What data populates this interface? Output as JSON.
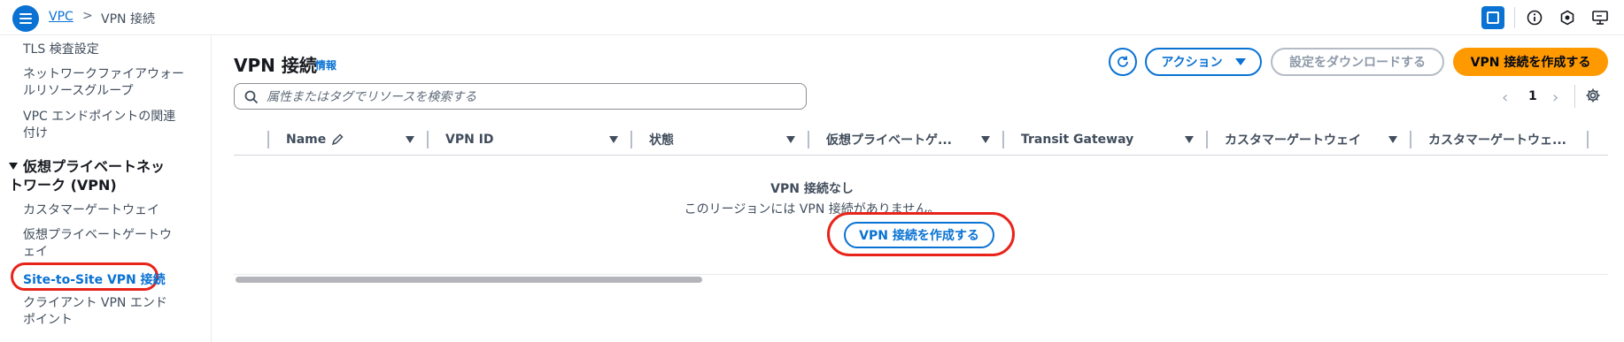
{
  "breadcrumb": {
    "service": "VPC",
    "separator": ">",
    "current": "VPN 接続"
  },
  "topbar_icons": [
    "split-panel-icon",
    "info-icon",
    "notifications-icon",
    "feedback-icon"
  ],
  "sidebar": {
    "items": [
      {
        "label": "TLS 検査設定"
      },
      {
        "label": "ネットワークファイアウォールリソースグループ"
      },
      {
        "label": "VPC エンドポイントの関連付け"
      }
    ],
    "section": "仮想プライベートネットワーク (VPN)",
    "section_items": [
      {
        "label": "カスタマーゲートウェイ"
      },
      {
        "label": "仮想プライベートゲートウェイ"
      },
      {
        "label": "Site-to-Site VPN 接続",
        "active": true
      },
      {
        "label": "クライアント VPN エンドポイント"
      }
    ]
  },
  "main": {
    "title": "VPN 接続",
    "info": "情報",
    "actions_label": "アクション",
    "download_label": "設定をダウンロードする",
    "create_label": "VPN 接続を作成する",
    "search_placeholder": "属性またはタグでリソースを検索する",
    "page_number": "1",
    "columns": [
      {
        "label": "Name"
      },
      {
        "label": "VPN ID"
      },
      {
        "label": "状態"
      },
      {
        "label": "仮想プライベートゲ..."
      },
      {
        "label": "Transit Gateway"
      },
      {
        "label": "カスタマーゲートウェイ"
      },
      {
        "label": "カスタマーゲートウェ..."
      }
    ],
    "empty_title": "VPN 接続なし",
    "empty_description": "このリージョンには VPN 接続がありません。",
    "empty_create_label": "VPN 接続を作成する"
  },
  "colors": {
    "accent": "#0972d3",
    "primary_button": "#ff9900",
    "highlight_ring": "#e8231a"
  }
}
